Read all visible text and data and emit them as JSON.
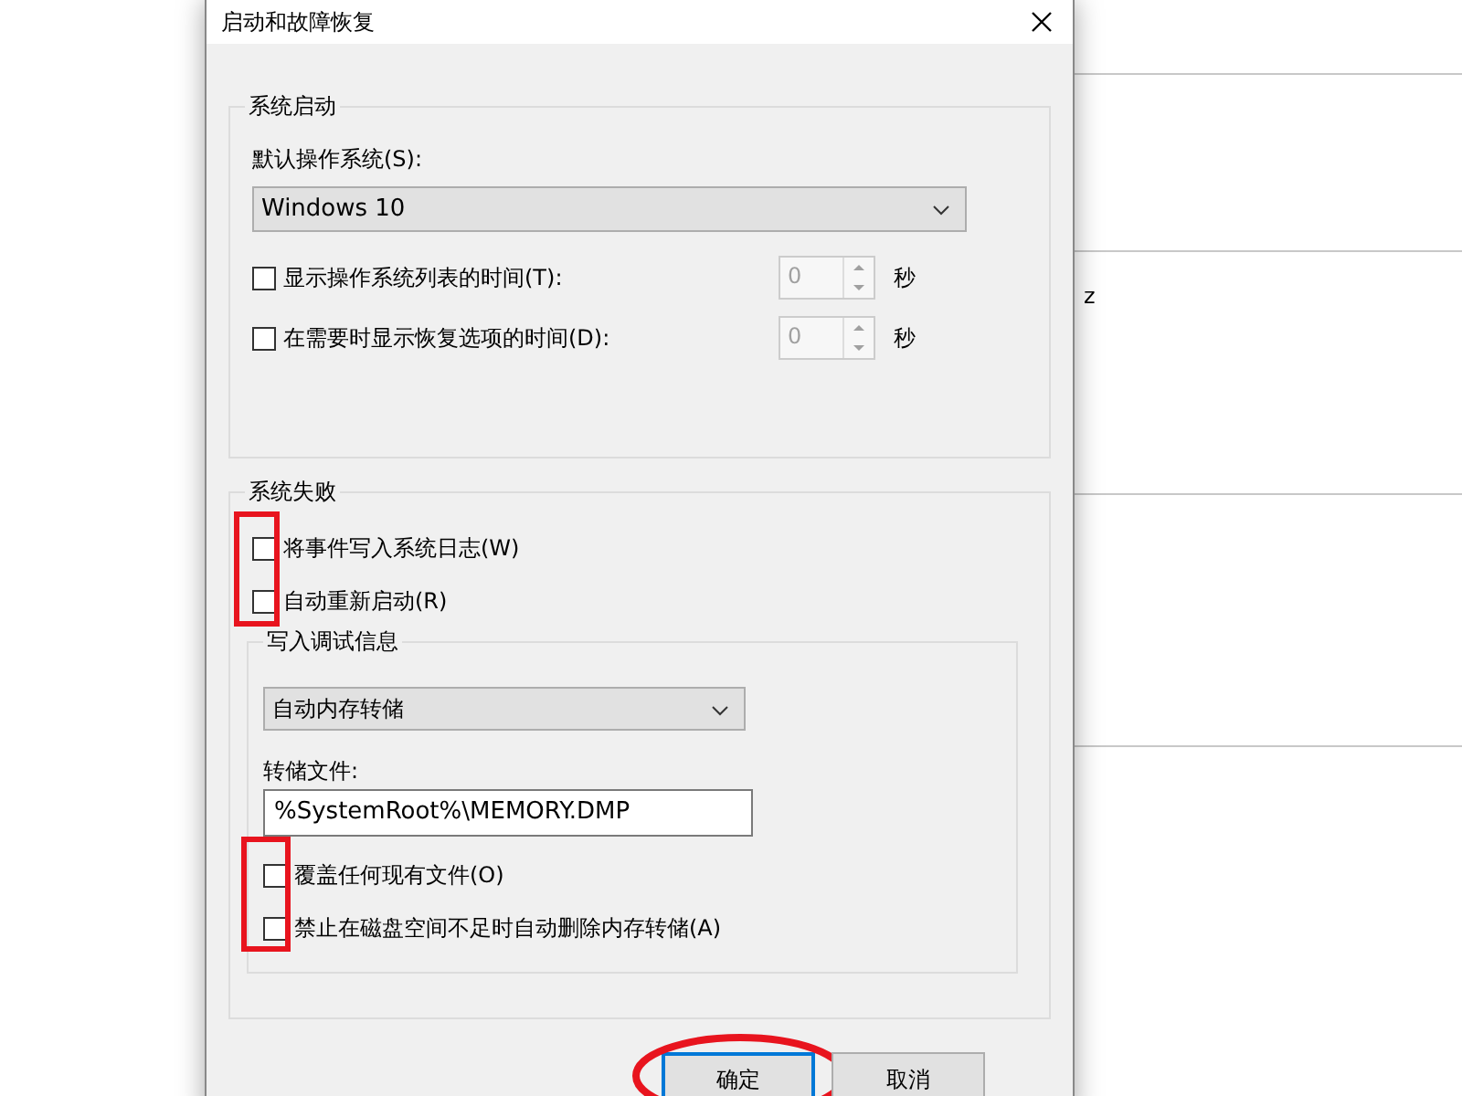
{
  "background": {
    "fragment": "z"
  },
  "dialog": {
    "title": "启动和故障恢复",
    "system_startup": {
      "label": "系统启动",
      "default_os_label": "默认操作系统(S):",
      "default_os": "Windows 10",
      "timers": [
        {
          "label": "显示操作系统列表的时间(T):",
          "checked": false,
          "value": "0",
          "unit": "秒",
          "disabled": true
        },
        {
          "label": "在需要时显示恢复选项的时间(D):",
          "checked": false,
          "value": "0",
          "unit": "秒",
          "disabled": true
        }
      ]
    },
    "system_failure": {
      "label": "系统失败",
      "marked": true,
      "options": [
        {
          "label": "将事件写入系统日志(W)",
          "checked": false
        },
        {
          "label": "自动重新启动(R)",
          "checked": false
        }
      ],
      "debug_info": {
        "label": "写入调试信息",
        "dump_type": "自动内存转储",
        "dump_file_label": "转储文件:",
        "dump_file": "%SystemRoot%\\MEMORY.DMP",
        "marked": true,
        "options": [
          {
            "label": "覆盖任何现有文件(O)",
            "checked": false
          },
          {
            "label": "禁止在磁盘空间不足时自动删除内存转储(A)",
            "checked": false
          }
        ]
      }
    },
    "buttons": [
      {
        "label": "确定",
        "default": true,
        "circled": true
      },
      {
        "label": "取消",
        "default": false,
        "circled": false
      }
    ]
  }
}
